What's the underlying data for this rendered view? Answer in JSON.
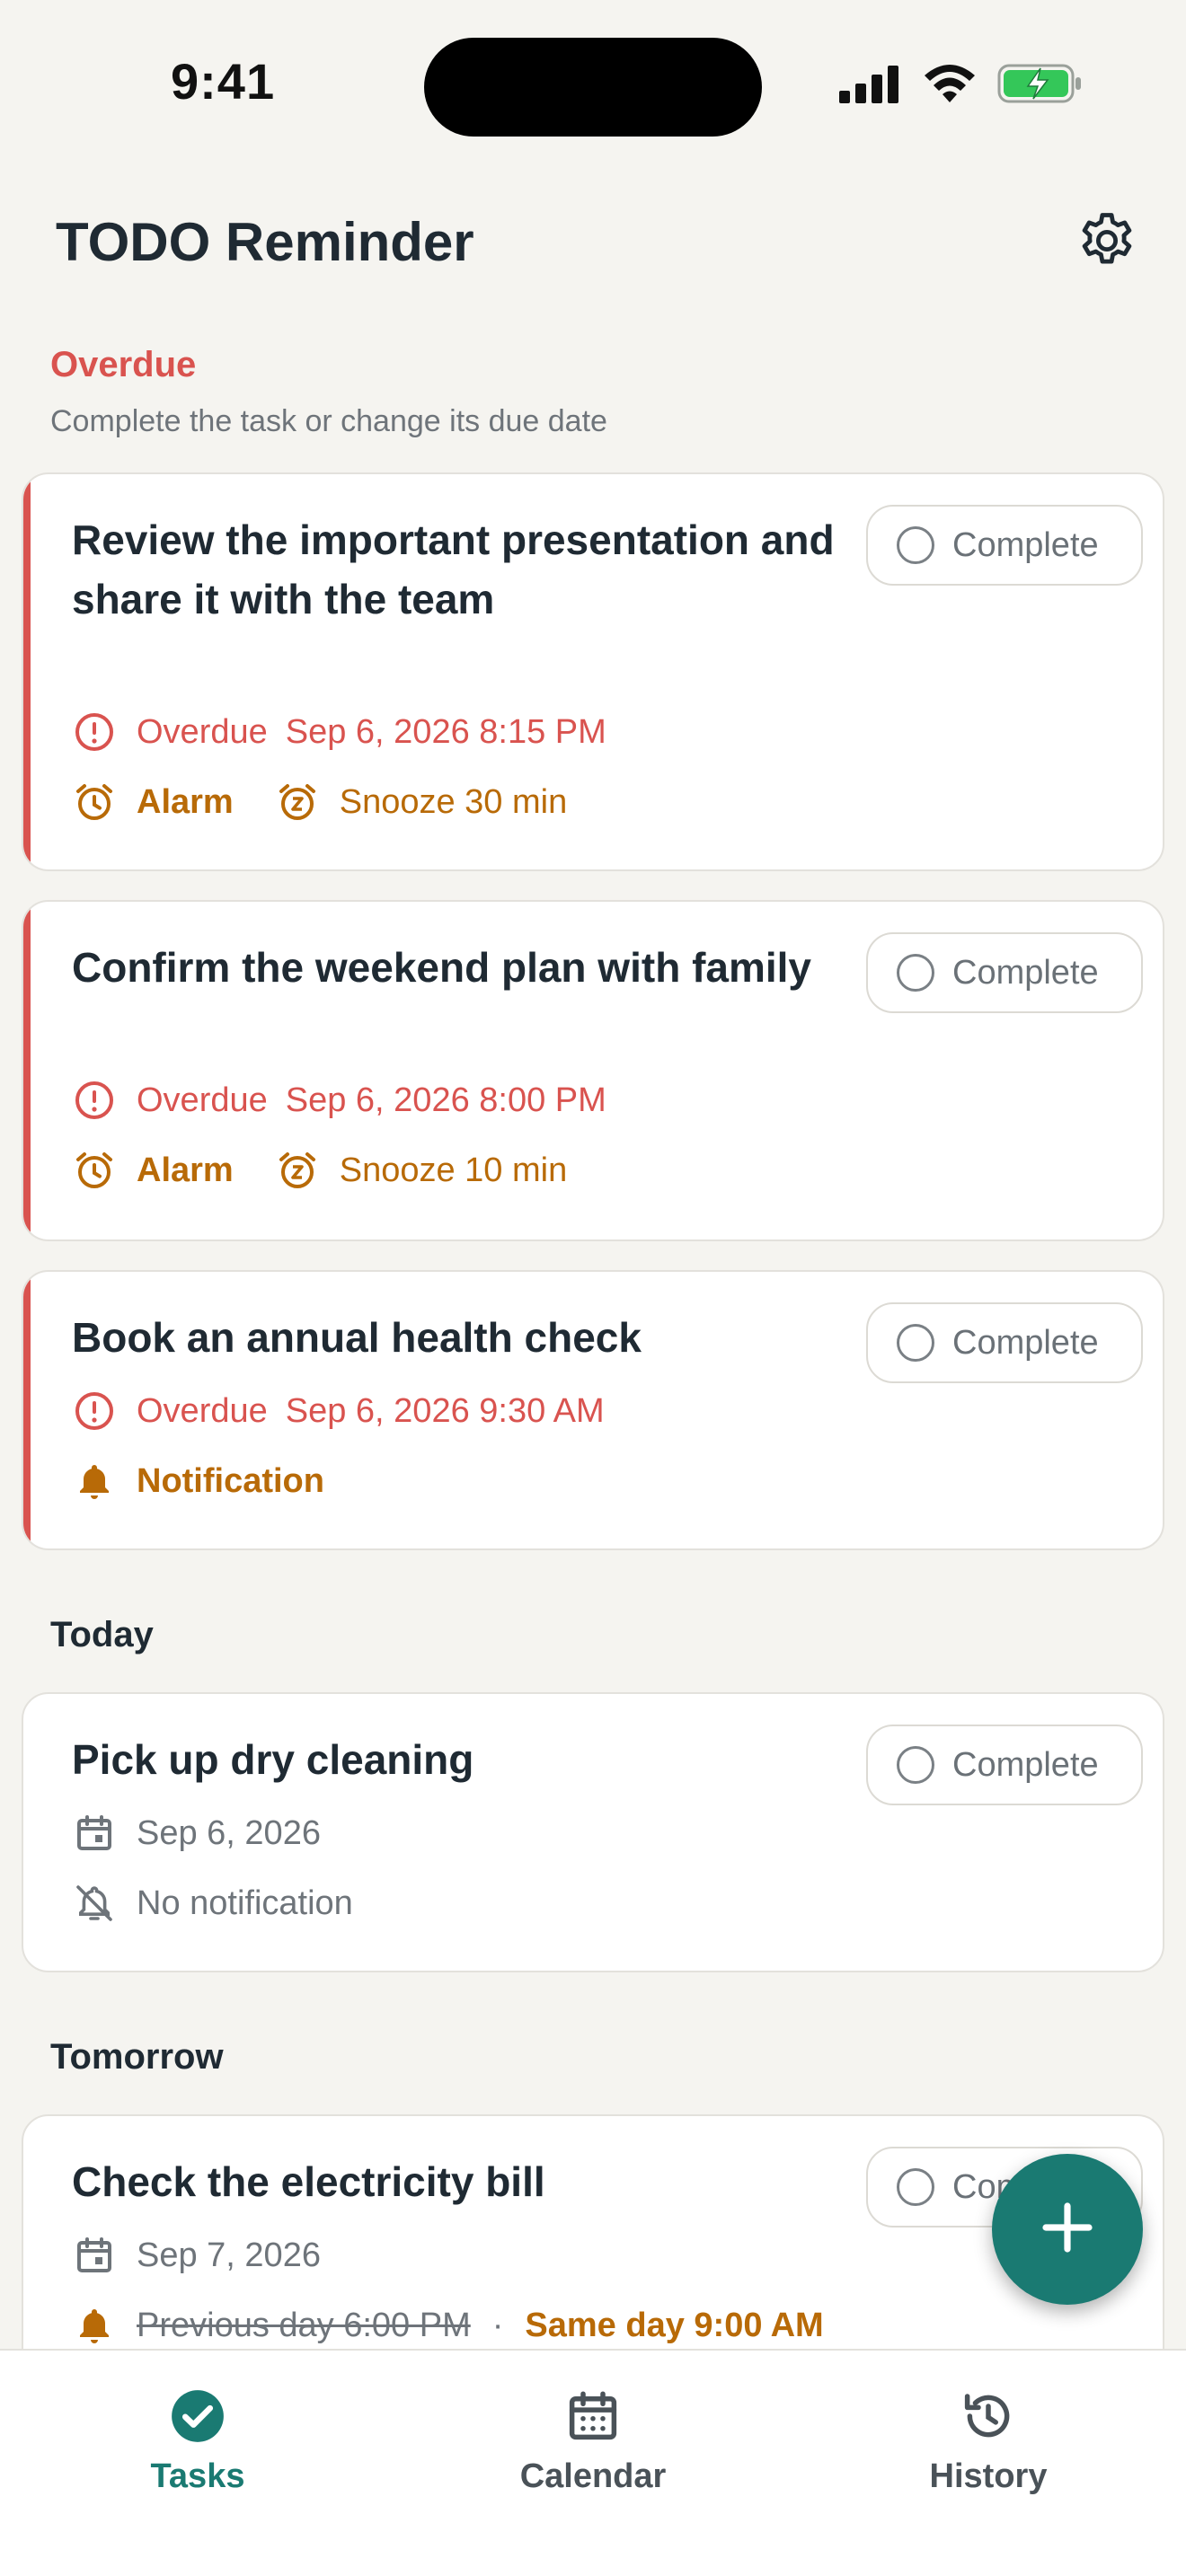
{
  "status_bar": {
    "time": "9:41"
  },
  "header": {
    "title": "TODO Reminder"
  },
  "overdue_section": {
    "title": "Overdue",
    "subtitle": "Complete the task or change its due date"
  },
  "complete_label": "Complete",
  "tasks_overdue": [
    {
      "title": "Review the important presentation and share it with the team",
      "status": "Overdue",
      "datetime": "Sep 6, 2026 8:15 PM",
      "type": "Alarm",
      "snooze": "Snooze 30 min"
    },
    {
      "title": "Confirm the weekend plan with family",
      "status": "Overdue",
      "datetime": "Sep 6, 2026 8:00 PM",
      "type": "Alarm",
      "snooze": "Snooze 10 min"
    },
    {
      "title": "Book an annual health check",
      "status": "Overdue",
      "datetime": "Sep 6, 2026 9:30 AM",
      "type": "Notification"
    }
  ],
  "today_section": {
    "title": "Today"
  },
  "task_today": {
    "title": "Pick up dry cleaning",
    "date": "Sep 6, 2026",
    "notification": "No notification"
  },
  "tomorrow_section": {
    "title": "Tomorrow"
  },
  "task_tomorrow": {
    "title": "Check the electricity bill",
    "date": "Sep 7, 2026",
    "previous_reminder": "Previous day 6:00 PM",
    "separator": "·",
    "current_reminder": "Same day 9:00 AM"
  },
  "tabbar": {
    "tasks": "Tasks",
    "calendar": "Calendar",
    "history": "History"
  },
  "colors": {
    "accent": "#1a7a72",
    "overdue": "#d9534f",
    "alarm": "#b86a07",
    "background": "#f5f4f0"
  }
}
